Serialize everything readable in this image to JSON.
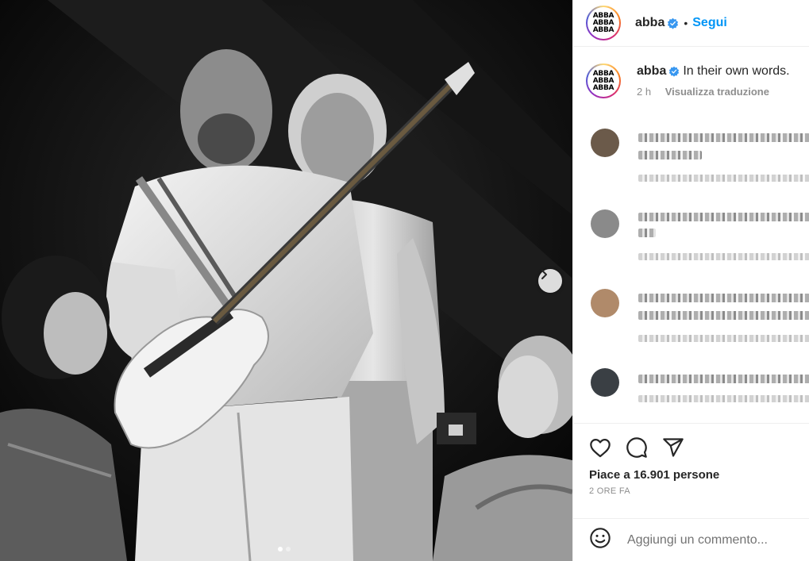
{
  "account": {
    "username": "abba",
    "verified": true,
    "separator": "•",
    "follow_label": "Segui",
    "logo_lines": [
      "ABBA",
      "ABBA",
      "ABBA"
    ]
  },
  "caption": {
    "username": "abba",
    "text": "In their own words.",
    "time": "2 h",
    "translate_label": "Visualizza traduzione"
  },
  "comments": [
    {
      "avatar_color": "#6b5a4a"
    },
    {
      "avatar_color": "#8a8a8a"
    },
    {
      "avatar_color": "#b08a6a"
    },
    {
      "avatar_color": "#3a3f44"
    }
  ],
  "engagement": {
    "likes_text": "Piace a 16.901 persone",
    "time_ago": "2 ORE FA"
  },
  "add_comment": {
    "placeholder": "Aggiungi un commento..."
  },
  "carousel": {
    "slide_count": 2,
    "active_index": 0
  },
  "colors": {
    "accent": "#0095f6",
    "verified": "#3897f0",
    "muted": "#8e8e8e"
  },
  "icons": [
    "verified-badge-icon",
    "chevron-right-icon",
    "heart-icon",
    "comment-icon",
    "share-icon",
    "emoji-icon"
  ]
}
